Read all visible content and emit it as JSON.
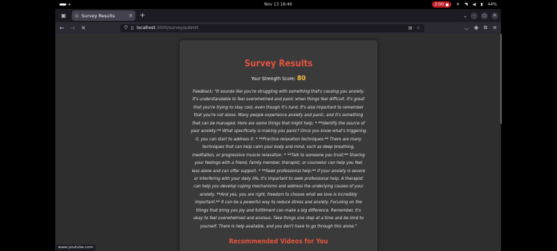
{
  "system": {
    "clock": "Nov 13  18:46",
    "record_time": "2:00",
    "battery": "44%"
  },
  "browser": {
    "tab_title": "Survey Results",
    "url_host": "localhost",
    "url_path": ":3000/survey/submit",
    "status_url": "www.youtube.com"
  },
  "page": {
    "title": "Survey Results",
    "score_label": "Your Strength Score:",
    "score_value": "80",
    "feedback": "Feedback: \"It sounds like you're struggling with something that's causing you anxiety. It's understandable to feel overwhelmed and panic when things feel difficult. It's great that you're trying to stay cool, even though it's hard. It's also important to remember that you're not alone. Many people experience anxiety and panic, and it's something that can be managed. Here are some things that might help: * **Identify the source of your anxiety:** What specifically is making you panic? Once you know what's triggering it, you can start to address it. * **Practice relaxation techniques:** There are many techniques that can help calm your body and mind, such as deep breathing, meditation, or progressive muscle relaxation. * **Talk to someone you trust:** Sharing your feelings with a friend, family member, therapist, or counselor can help you feel less alone and can offer support. * **Seek professional help:** If your anxiety is severe or interfering with your daily life, it's important to seek professional help. A therapist can help you develop coping mechanisms and address the underlying causes of your anxiety. **And yes, you are right, freedom to choose what we love is incredibly important.** It can be a powerful way to reduce stress and anxiety. Focusing on the things that bring you joy and fulfillment can make a big difference. Remember, it's okay to feel overwhelmed and anxious. Take things one step at a time and be kind to yourself. There is help available, and you don't have to go through this alone.\"",
    "videos_heading": "Recommended Videos for You"
  }
}
